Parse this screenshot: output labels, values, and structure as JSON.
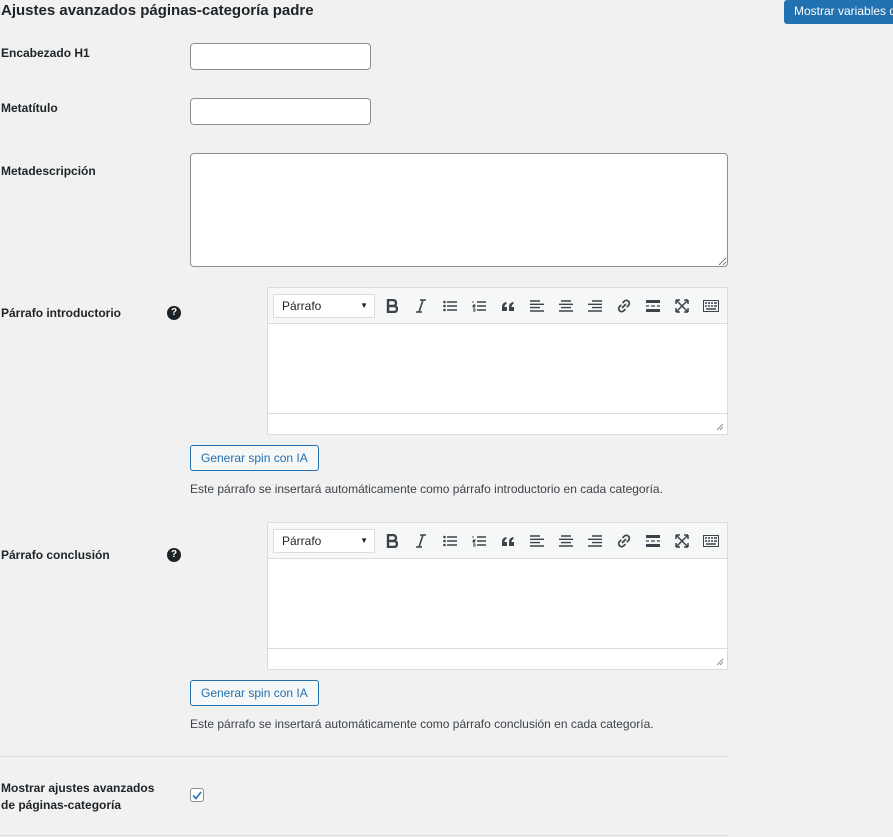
{
  "header": {
    "title": "Ajustes avanzados páginas-categoría padre",
    "show_vars_button": "Mostrar variables d"
  },
  "fields": {
    "h1_label": "Encabezado H1",
    "h1_value": "",
    "metatitle_label": "Metatítulo",
    "metatitle_value": "",
    "metadesc_label": "Metadescripción",
    "metadesc_value": ""
  },
  "intro": {
    "label": "Párrafo introductorio",
    "help_icon": "question-circle-icon",
    "format": "Párrafo",
    "ai_button": "Generar spin con IA",
    "description": "Este párrafo se insertará automáticamente como párrafo introductorio en cada categoría."
  },
  "conclusion": {
    "label": "Párrafo conclusión",
    "help_icon": "question-circle-icon",
    "format": "Párrafo",
    "ai_button": "Generar spin con IA",
    "description": "Este párrafo se insertará automáticamente como párrafo conclusión en cada categoría."
  },
  "toolbar_icons": [
    "bold-icon",
    "italic-icon",
    "bullet-list-icon",
    "numbered-list-icon",
    "blockquote-icon",
    "align-left-icon",
    "align-center-icon",
    "align-right-icon",
    "link-icon",
    "read-more-icon",
    "fullscreen-icon",
    "toolbar-toggle-icon"
  ],
  "advanced": {
    "label": "Mostrar ajustes avanzados de páginas-categoría",
    "checked": true
  },
  "colors": {
    "accent": "#2271b1",
    "background": "#f1f1f1",
    "text": "#1d2327"
  }
}
